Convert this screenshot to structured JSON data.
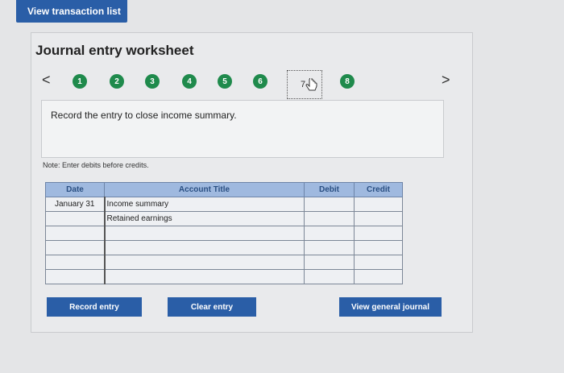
{
  "top_button": "View transaction list",
  "worksheet_title": "Journal entry worksheet",
  "nav": {
    "prev": "<",
    "next": ">",
    "steps": [
      "1",
      "2",
      "3",
      "4",
      "5",
      "6",
      "7",
      "8"
    ],
    "current_step": "7"
  },
  "instruction": "Record the entry to close income summary.",
  "note": "Note: Enter debits before credits.",
  "table": {
    "headers": {
      "date": "Date",
      "account": "Account Title",
      "debit": "Debit",
      "credit": "Credit"
    },
    "rows": [
      {
        "date": "January 31",
        "account": "Income summary",
        "debit": "",
        "credit": ""
      },
      {
        "date": "",
        "account": "Retained earnings",
        "debit": "",
        "credit": ""
      },
      {
        "date": "",
        "account": "",
        "debit": "",
        "credit": ""
      },
      {
        "date": "",
        "account": "",
        "debit": "",
        "credit": ""
      },
      {
        "date": "",
        "account": "",
        "debit": "",
        "credit": ""
      },
      {
        "date": "",
        "account": "",
        "debit": "",
        "credit": ""
      }
    ]
  },
  "buttons": {
    "record": "Record entry",
    "clear": "Clear entry",
    "view_journal": "View general journal"
  },
  "colors": {
    "step_green": "#1f8a4c",
    "button_blue": "#2a5ea7",
    "header_blue": "#9fb9df"
  }
}
